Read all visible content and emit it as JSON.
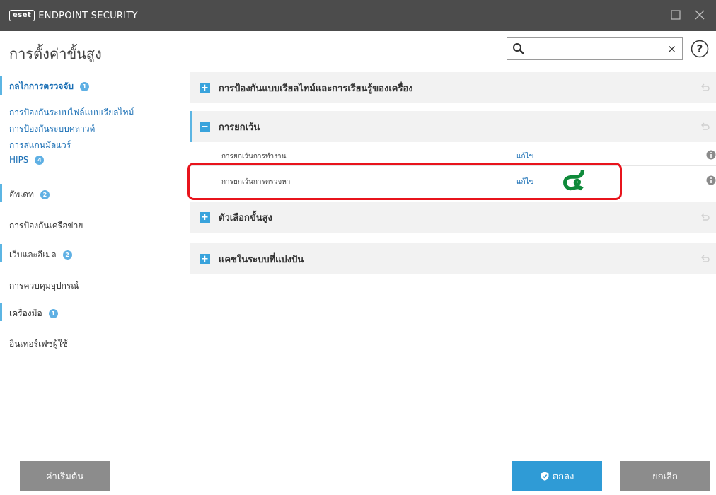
{
  "window": {
    "logo": "eset",
    "app_title": "ENDPOINT SECURITY"
  },
  "header": {
    "page_title": "การตั้งค่าขั้นสูง",
    "search": {
      "value": "",
      "placeholder": "",
      "clear_label": "×"
    },
    "help_label": "?"
  },
  "sidebar": {
    "items": [
      {
        "label": "กลไกการตรวจจับ",
        "badge": "1",
        "active": true
      },
      {
        "label": "การป้องกันระบบไฟล์แบบเรียลไทม์",
        "sub": true
      },
      {
        "label": "การป้องกันระบบคลาวด์",
        "sub": true
      },
      {
        "label": "การสแกนมัลแวร์",
        "sub": true
      },
      {
        "label": "HIPS",
        "badge": "4",
        "sub": true
      },
      {
        "label": "อัพเดท",
        "badge": "2"
      },
      {
        "label": "การป้องกันเครือข่าย"
      },
      {
        "label": "เว็บและอีเมล",
        "badge": "2"
      },
      {
        "label": "การควบคุมอุปกรณ์"
      },
      {
        "label": "เครื่องมือ",
        "badge": "1"
      },
      {
        "label": "อินเทอร์เฟซผู้ใช้"
      }
    ]
  },
  "main": {
    "sections": [
      {
        "label": "การป้องกันแบบเรียลไทม์และการเรียนรู้ของเครื่อง",
        "expanded": false,
        "toggle": "+"
      },
      {
        "label": "การยกเว้น",
        "expanded": true,
        "toggle": "−"
      },
      {
        "label": "ตัวเลือกขั้นสูง",
        "expanded": false,
        "toggle": "+"
      },
      {
        "label": "แคชในระบบที่แบ่งปัน",
        "expanded": false,
        "toggle": "+"
      }
    ],
    "exclusion_rows": [
      {
        "label": "การยกเว้นการทำงาน",
        "link": "แก้ไข"
      },
      {
        "label": "การยกเว้นการตรวจหา",
        "link": "แก้ไข"
      }
    ],
    "annotation": {
      "mark": "๔",
      "color": "#0f8a3a",
      "highlight_color": "#e8141c"
    }
  },
  "footer": {
    "default_label": "ค่าเริ่มต้น",
    "ok_label": "ตกลง",
    "cancel_label": "ยกเลิก"
  },
  "colors": {
    "titlebar": "#4c4c4c",
    "accent": "#2f9bd6",
    "link": "#1a6fb5",
    "badge": "#5fb0e4"
  }
}
